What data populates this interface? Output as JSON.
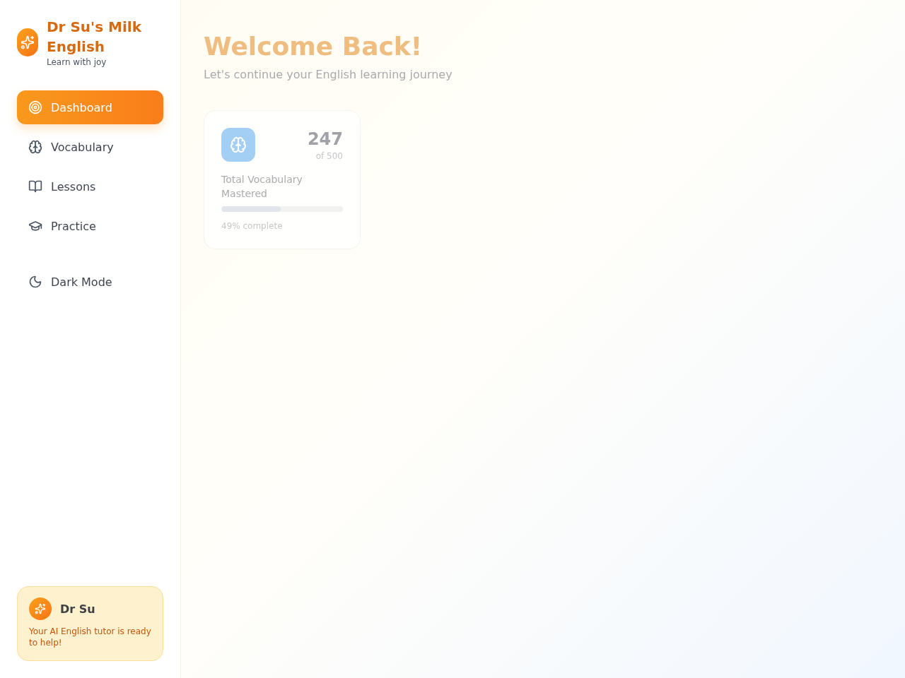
{
  "brand": {
    "title": "Dr Su's Milk English",
    "tagline": "Learn with joy"
  },
  "nav": [
    {
      "label": "Dashboard",
      "selected": true
    },
    {
      "label": "Vocabulary",
      "selected": false
    },
    {
      "label": "Lessons",
      "selected": false
    },
    {
      "label": "Practice",
      "selected": false
    }
  ],
  "theme_toggle": {
    "label": "Dark Mode"
  },
  "tutor_card": {
    "name": "Dr Su",
    "message": "Your AI English tutor is ready to help!"
  },
  "header": {
    "title": "Welcome Back!",
    "subtitle": "Let's continue your English learning journey"
  },
  "stats": [
    {
      "value": "247",
      "total": "of 500",
      "label": "Total Vocabulary Mastered",
      "level": 0.49,
      "progress_text": "49% complete"
    }
  ]
}
